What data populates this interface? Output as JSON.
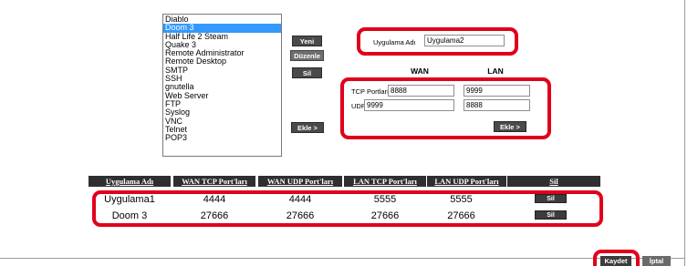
{
  "app_list": {
    "items": [
      "Diablo",
      "Doom 3",
      "Half Life 2 Steam",
      "Quake 3",
      "Remote Administrator",
      "Remote Desktop",
      "SMTP",
      "SSH",
      "gnutella",
      "Web Server",
      "FTP",
      "Syslog",
      "VNC",
      "Telnet",
      "POP3"
    ],
    "selected_index": 1
  },
  "buttons": {
    "new": "Yeni",
    "edit": "Düzenle",
    "delete": "Sil",
    "add_left": "Ekle >",
    "add_right": "Ekle >",
    "save": "Kaydet",
    "cancel": "İptal"
  },
  "app_name": {
    "label": "Uygulama Adı",
    "value": "Uygulama2"
  },
  "ports": {
    "wan_header": "WAN",
    "lan_header": "LAN",
    "tcp_label": "TCP Portları",
    "udp_label": "UDP Portları",
    "wan_tcp": "8888",
    "lan_tcp": "9999",
    "wan_udp": "9999",
    "lan_udp": "8888"
  },
  "table": {
    "headers": [
      "Uygulama Adı",
      "WAN TCP Port'ları",
      "WAN UDP Port'ları",
      "LAN TCP Port'ları",
      "LAN UDP Port'ları",
      "Sil"
    ],
    "rows": [
      {
        "name": "Uygulama1",
        "wan_tcp": "4444",
        "wan_udp": "4444",
        "lan_tcp": "5555",
        "lan_udp": "5555",
        "delete": "Sil"
      },
      {
        "name": "Doom 3",
        "wan_tcp": "27666",
        "wan_udp": "27666",
        "lan_tcp": "27666",
        "lan_udp": "27666",
        "delete": "Sil"
      }
    ]
  },
  "colors": {
    "highlight": "#e0001b",
    "selected": "#3399ff",
    "header_bg": "#2f2f2f"
  }
}
